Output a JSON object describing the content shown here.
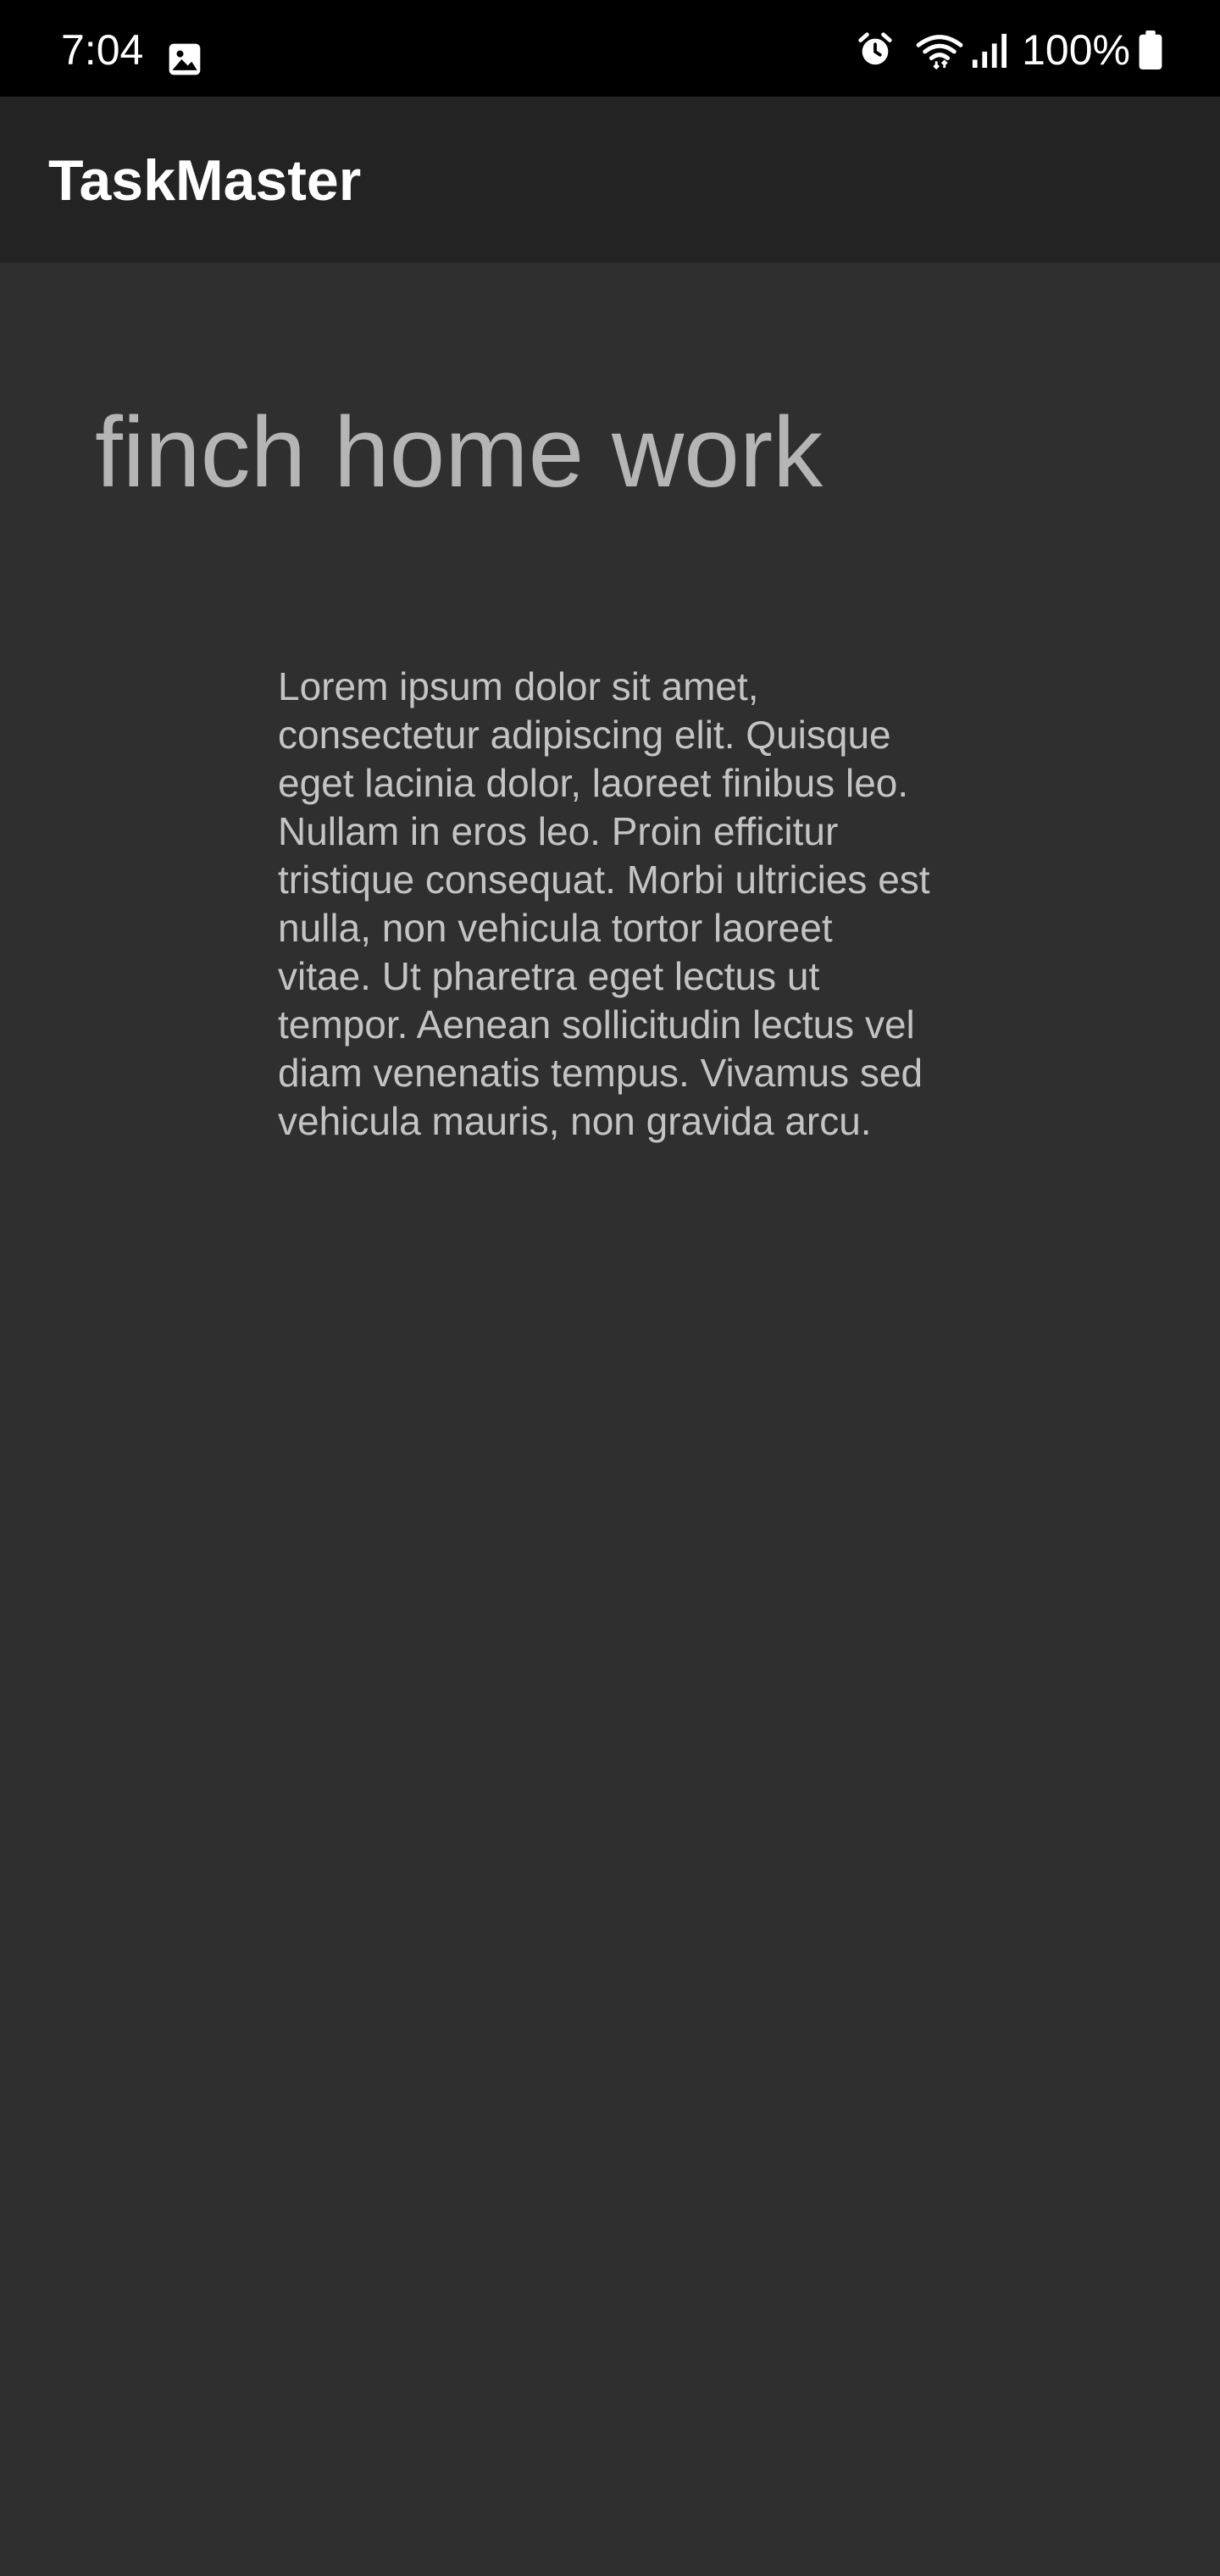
{
  "status_bar": {
    "time": "7:04",
    "battery_percent": "100%",
    "icons": [
      "gallery-icon",
      "alarm-icon",
      "wifi-icon",
      "signal-icon",
      "battery-icon"
    ]
  },
  "app_bar": {
    "title": "TaskMaster"
  },
  "task": {
    "title": "finch home work",
    "description": "Lorem ipsum dolor sit amet, consectetur adipiscing elit. Quisque eget lacinia dolor, laoreet finibus leo. Nullam in eros leo. Proin efficitur tristique consequat. Morbi ultricies est nulla, non vehicula tortor laoreet vitae. Ut pharetra eget lectus ut tempor. Aenean sollicitudin lectus vel diam venenatis tempus. Vivamus sed vehicula mauris, non gravida arcu."
  },
  "colors": {
    "status_bar_bg": "#000000",
    "app_bar_bg": "#232323",
    "content_bg": "#2f2f2f",
    "title_text": "#b5b5b5",
    "body_text": "#c4c4c4"
  }
}
